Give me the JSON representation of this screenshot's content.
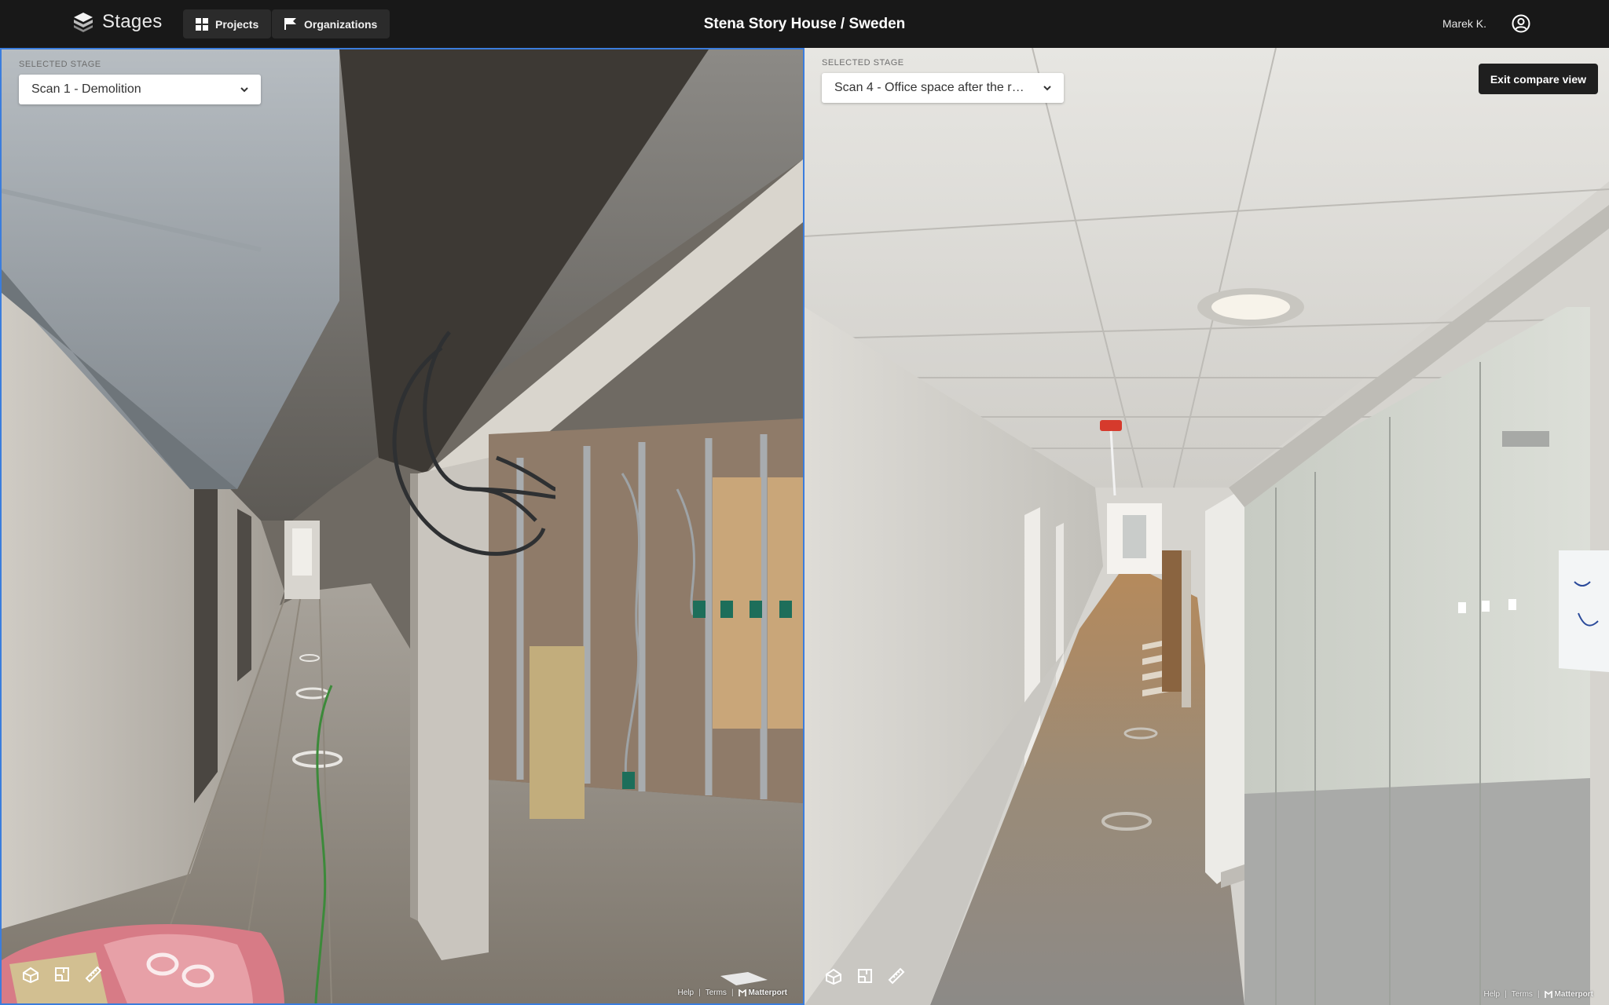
{
  "app": {
    "logo_text": "Stages",
    "nav": {
      "projects_label": "Projects",
      "organizations_label": "Organizations"
    },
    "title": "Stena Story House / Sweden",
    "user_name": "Marek K."
  },
  "left_pane": {
    "stage_label": "SELECTED STAGE",
    "stage_value": "Scan 1 - Demolition"
  },
  "right_pane": {
    "stage_label": "SELECTED STAGE",
    "stage_value": "Scan 4 - Office space after the ren...",
    "exit_label": "Exit compare view"
  },
  "footer": {
    "help": "Help",
    "terms": "Terms",
    "brand": "Matterport"
  },
  "icons": [
    "stages-logo-icon",
    "projects-grid-icon",
    "organizations-flag-icon",
    "account-icon",
    "chevron-down-icon",
    "dollhouse-icon",
    "floorplan-icon",
    "measure-icon",
    "matterport-icon"
  ],
  "colors": {
    "topbar": "#181818",
    "nav_button": "#2b2b2b",
    "selected_pane_border": "#3b7ddd",
    "exit_button": "#1f1f1f"
  }
}
